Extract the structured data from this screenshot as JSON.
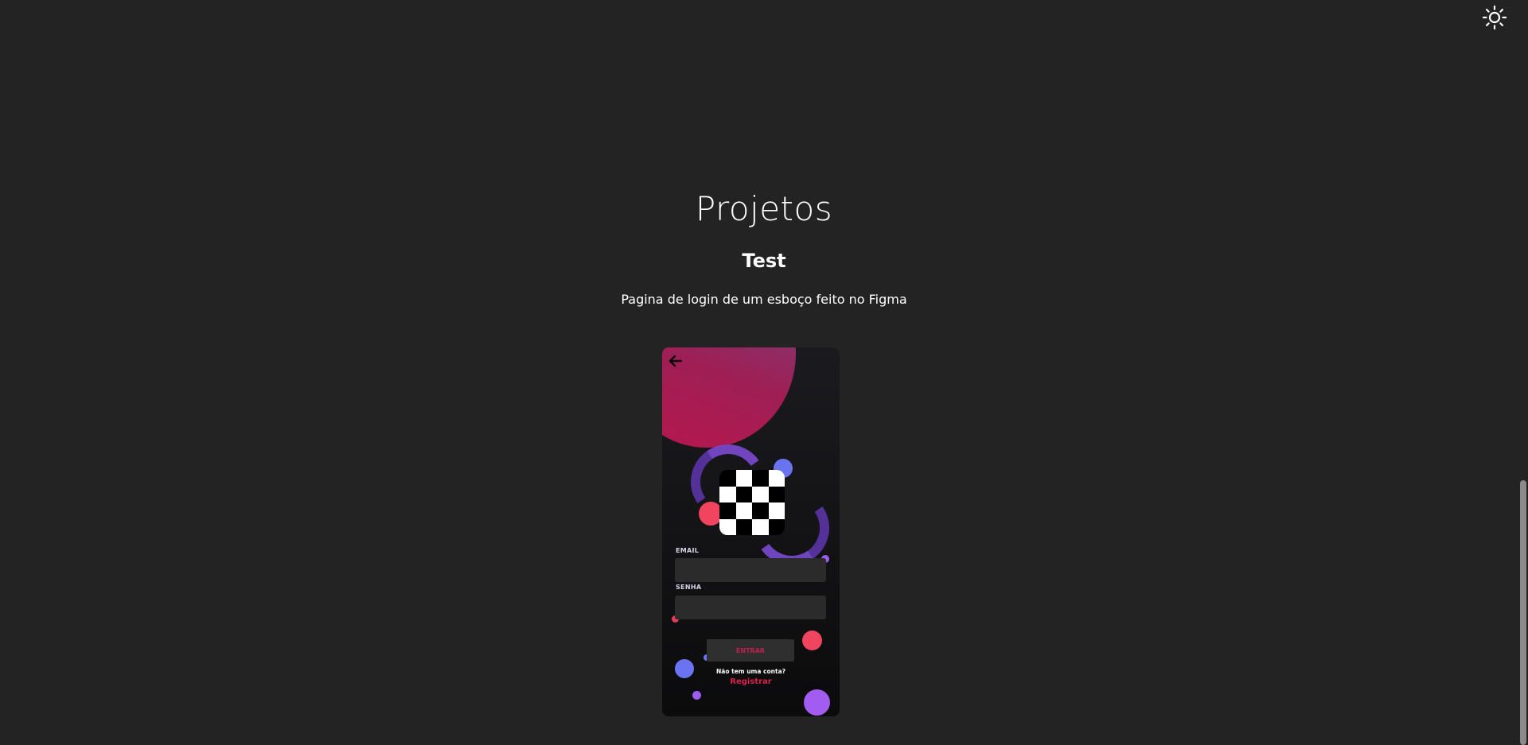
{
  "header": {
    "theme_toggle_icon": "sun-icon"
  },
  "section": {
    "title": "Projetos"
  },
  "project": {
    "name": "Test",
    "description": "Pagina de login de um esboço feito no Figma",
    "preview": {
      "back_icon": "arrow-left-icon",
      "logo_icon": "checkerboard-icon",
      "email_label": "EMAIL",
      "password_label": "SENHA",
      "submit_label": "ENTRAR",
      "no_account_text": "Não tem uma conta?",
      "register_link": "Registrar"
    }
  },
  "colors": {
    "background": "#232323",
    "accent_red": "#d8224d",
    "accent_purple": "#7a4bd0",
    "accent_blue": "#6a74f0"
  }
}
